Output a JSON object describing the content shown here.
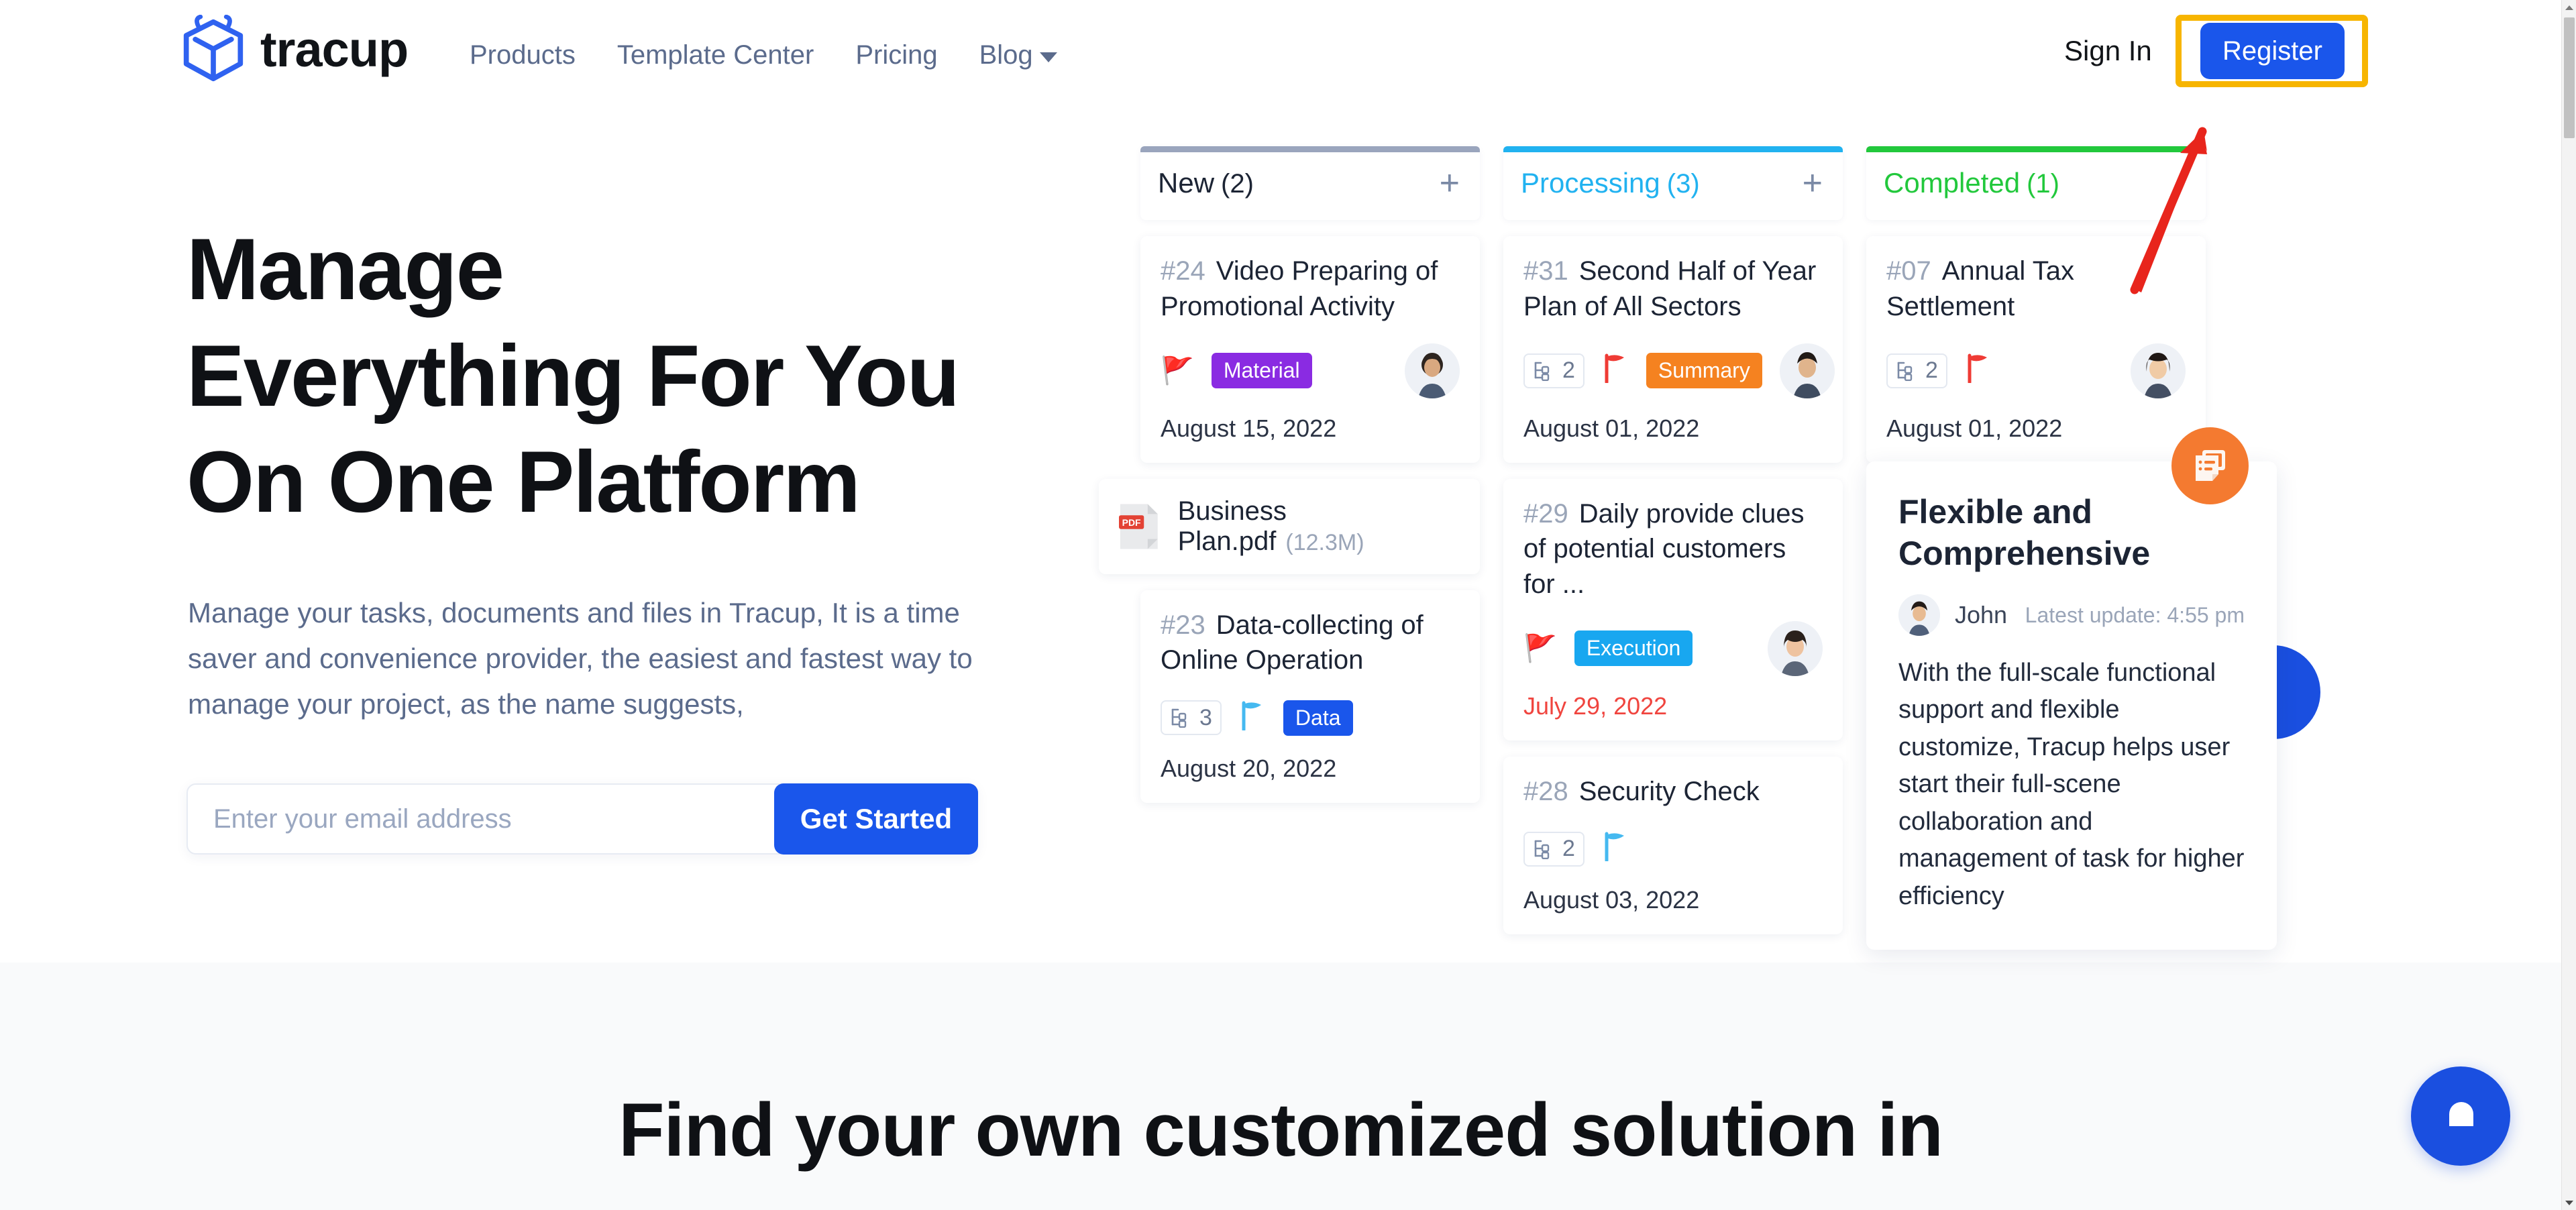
{
  "brand": {
    "name": "tracup",
    "logo_icon": "tracup-cube-logo",
    "accent": "#1a56eb"
  },
  "nav": {
    "items": [
      {
        "label": "Products",
        "icon": null
      },
      {
        "label": "Template Center",
        "icon": null
      },
      {
        "label": "Pricing",
        "icon": null
      },
      {
        "label": "Blog",
        "icon": "chevron-down-icon"
      }
    ],
    "sign_in": "Sign In",
    "register": "Register",
    "register_highlight_color": "#f7b500"
  },
  "hero": {
    "title_lines": [
      "Manage",
      "Everything For You",
      "On One Platform"
    ],
    "subtitle": "Manage your tasks, documents and files in Tracup, It is a time saver and convenience provider, the easiest and fastest way to manage your project, as the name suggests,",
    "email_placeholder": "Enter your email address",
    "email_value": "",
    "cta_label": "Get Started"
  },
  "board": {
    "columns": [
      {
        "title": "New",
        "count": "(2)",
        "accent": "#9aa5bd",
        "title_color": "#1c2434",
        "add_icon": "plus-icon",
        "cards": [
          {
            "id": "#24",
            "title": "Video Preparing of Promotional Activity",
            "subtasks": null,
            "flag": "yellow",
            "tag": {
              "label": "Material",
              "color": "#8a2be2"
            },
            "avatar": "male-1",
            "date": "August 15, 2022",
            "overdue": false
          }
        ],
        "file": {
          "name": "Business Plan.pdf",
          "size": "(12.3M)",
          "type": "PDF"
        },
        "cards_after_file": [
          {
            "id": "#23",
            "title": "Data-collecting of Online Operation",
            "subtasks": "3",
            "flag": "blue",
            "tag": {
              "label": "Data",
              "color": "#1a56eb"
            },
            "avatar": null,
            "date": "August 20, 2022",
            "overdue": false
          }
        ]
      },
      {
        "title": "Processing",
        "count": "(3)",
        "accent": "#21b2f0",
        "title_color": "#21b2f0",
        "add_icon": "plus-icon",
        "cards": [
          {
            "id": "#31",
            "title": "Second Half of Year Plan of All Sectors",
            "subtasks": "2",
            "flag": "red",
            "tag": {
              "label": "Summary",
              "color": "#f58220"
            },
            "avatar": "male-2",
            "date": "August 01, 2022",
            "overdue": false
          },
          {
            "id": "#29",
            "title": "Daily provide clues of potential customers for ...",
            "subtasks": null,
            "flag": "yellow",
            "tag": {
              "label": "Execution",
              "color": "#18a7f0"
            },
            "avatar": "female-1",
            "date": "July 29, 2022",
            "overdue": true
          },
          {
            "id": "#28",
            "title": "Security Check",
            "subtasks": "2",
            "flag": "blue",
            "tag": null,
            "avatar": null,
            "date": "August 03, 2022",
            "overdue": false
          }
        ],
        "file": null,
        "cards_after_file": []
      },
      {
        "title": "Completed",
        "count": "(1)",
        "accent": "#22c83c",
        "title_color": "#22c83c",
        "add_icon": "plus-icon",
        "cards": [
          {
            "id": "#07",
            "title": "Annual Tax Settlement",
            "subtasks": "2",
            "flag": "red",
            "tag": null,
            "avatar": "female-2",
            "date": "August 01, 2022",
            "overdue": false
          }
        ],
        "file": null,
        "cards_after_file": []
      }
    ]
  },
  "feature_panel": {
    "title": "Flexible and Comprehensive",
    "author": "John",
    "update": "Latest update: 4:55 pm",
    "body": "With the full-scale functional support and flexible customize, Tracup helps user start their full-scene collaboration and management of task for higher efficiency",
    "badge_icon": "document-list-icon",
    "badge_color": "#f47a30"
  },
  "second_section": {
    "heading": "Find your own customized solution in"
  },
  "chat": {
    "icon": "chat-bubble-icon",
    "color": "#1a4fe0"
  },
  "annotation": {
    "arrow_color": "#e8251c",
    "points_to": "register-button"
  },
  "scrollbar": {
    "up_icon": "scroll-up-arrow-icon",
    "down_icon": "scroll-down-arrow-icon"
  }
}
